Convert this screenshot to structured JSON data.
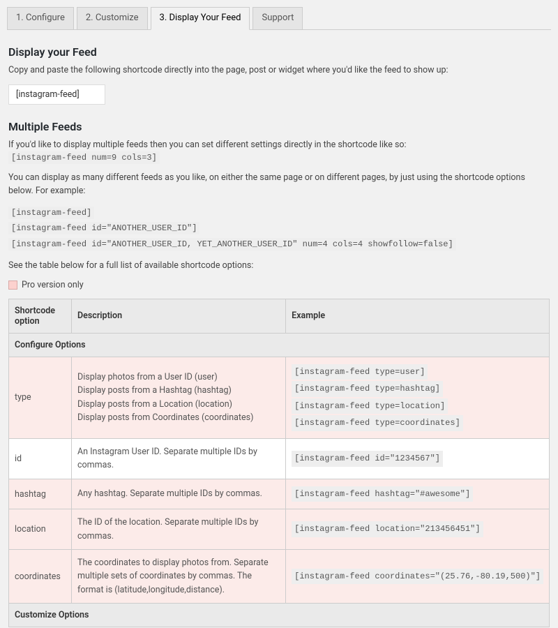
{
  "tabs": {
    "configure": "1. Configure",
    "customize": "2. Customize",
    "display": "3. Display Your Feed",
    "support": "Support"
  },
  "display_feed": {
    "heading": "Display your Feed",
    "intro": "Copy and paste the following shortcode directly into the page, post or widget where you'd like the feed to show up:",
    "shortcode_value": "[instagram-feed]"
  },
  "multiple_feeds": {
    "heading": "Multiple Feeds",
    "para1_pre": "If you'd like to display multiple feeds then you can set different settings directly in the shortcode like so: ",
    "para1_code": "[instagram-feed num=9 cols=3]",
    "para2": "You can display as many different feeds as you like, on either the same page or on different pages, by just using the shortcode options below. For example:",
    "example_lines": [
      "[instagram-feed]",
      "[instagram-feed id=\"ANOTHER_USER_ID\"]",
      "[instagram-feed id=\"ANOTHER_USER_ID, YET_ANOTHER_USER_ID\" num=4 cols=4 showfollow=false]"
    ],
    "para3": "See the table below for a full list of available shortcode options:",
    "pro_label": "Pro version only"
  },
  "table": {
    "headers": {
      "option": "Shortcode option",
      "description": "Description",
      "example": "Example"
    },
    "section1": "Configure Options",
    "rows": [
      {
        "pro": true,
        "option": "type",
        "desc_lines": [
          "Display photos from a User ID (user)",
          "Display posts from a Hashtag (hashtag)",
          "Display posts from a Location (location)",
          "Display posts from Coordinates (coordinates)"
        ],
        "ex_lines": [
          "[instagram-feed type=user]",
          "[instagram-feed type=hashtag]",
          "[instagram-feed type=location]",
          "[instagram-feed type=coordinates]"
        ]
      },
      {
        "pro": false,
        "option": "id",
        "desc_lines": [
          "An Instagram User ID. Separate multiple IDs by commas."
        ],
        "ex_lines": [
          "[instagram-feed id=\"1234567\"]"
        ]
      },
      {
        "pro": true,
        "option": "hashtag",
        "desc_lines": [
          "Any hashtag. Separate multiple IDs by commas."
        ],
        "ex_lines": [
          "[instagram-feed hashtag=\"#awesome\"]"
        ]
      },
      {
        "pro": true,
        "option": "location",
        "desc_lines": [
          "The ID of the location. Separate multiple IDs by commas."
        ],
        "ex_lines": [
          "[instagram-feed location=\"213456451\"]"
        ]
      },
      {
        "pro": true,
        "option": "coordinates",
        "desc_lines": [
          "The coordinates to display photos from. Separate multiple sets of coordinates by commas. The format is (latitude,longitude,distance)."
        ],
        "ex_lines": [
          "[instagram-feed coordinates=\"(25.76,-80.19,500)\"]"
        ]
      }
    ],
    "section2": "Customize Options"
  }
}
